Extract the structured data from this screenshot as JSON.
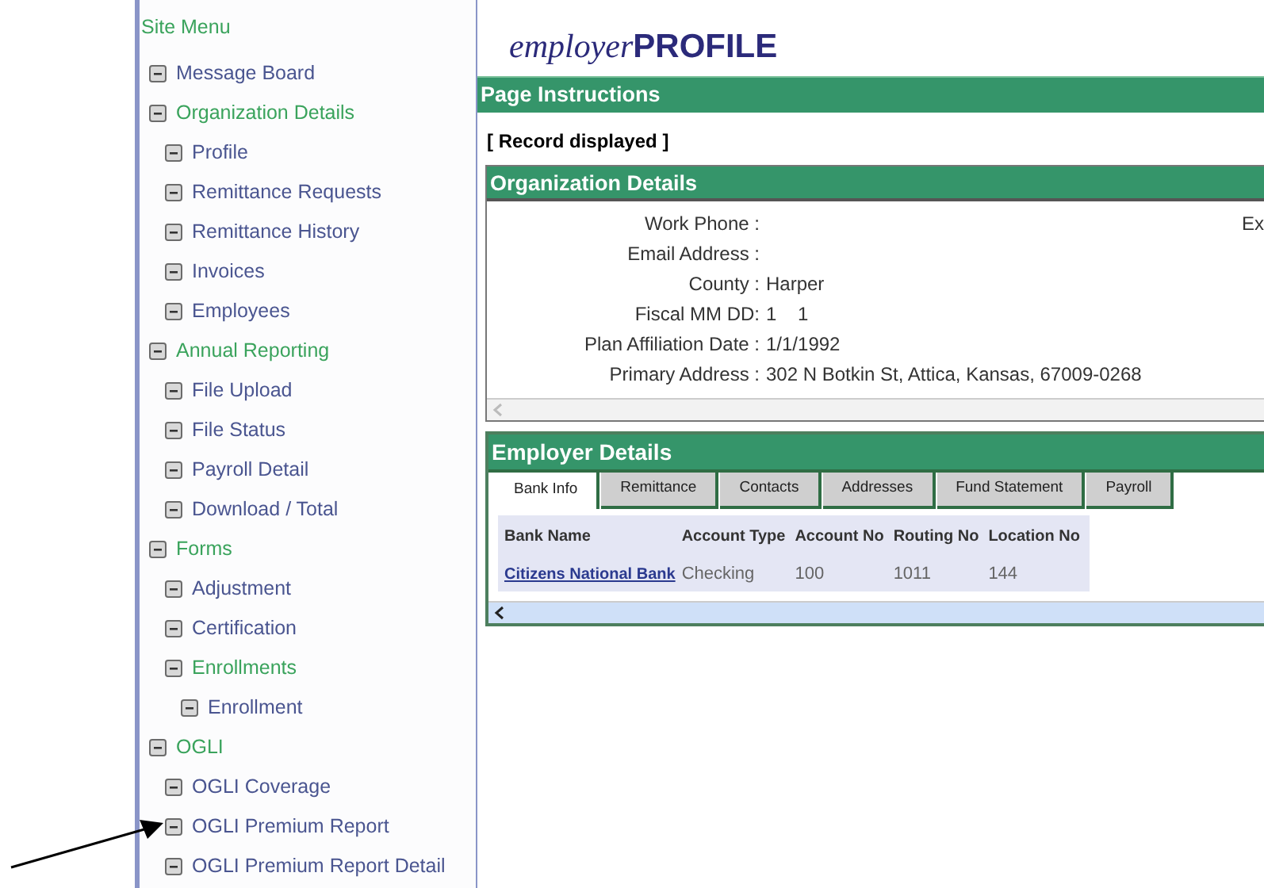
{
  "sidebar": {
    "title": "Site Menu",
    "items": [
      {
        "label": "Message Board",
        "kind": "link"
      },
      {
        "label": "Organization Details",
        "kind": "group",
        "children": [
          {
            "label": "Profile",
            "kind": "link"
          },
          {
            "label": "Remittance Requests",
            "kind": "link"
          },
          {
            "label": "Remittance History",
            "kind": "link"
          },
          {
            "label": "Invoices",
            "kind": "link"
          },
          {
            "label": "Employees",
            "kind": "link"
          }
        ]
      },
      {
        "label": "Annual Reporting",
        "kind": "group",
        "children": [
          {
            "label": "File Upload",
            "kind": "link"
          },
          {
            "label": "File Status",
            "kind": "link"
          },
          {
            "label": "Payroll Detail",
            "kind": "link"
          },
          {
            "label": "Download / Total",
            "kind": "link"
          }
        ]
      },
      {
        "label": "Forms",
        "kind": "group",
        "children": [
          {
            "label": "Adjustment",
            "kind": "link"
          },
          {
            "label": "Certification",
            "kind": "link"
          },
          {
            "label": "Enrollments",
            "kind": "group",
            "children": [
              {
                "label": "Enrollment",
                "kind": "link"
              }
            ]
          }
        ]
      },
      {
        "label": "OGLI",
        "kind": "group",
        "children": [
          {
            "label": "OGLI Coverage",
            "kind": "link"
          },
          {
            "label": "OGLI Premium Report",
            "kind": "link"
          },
          {
            "label": "OGLI Premium Report Detail",
            "kind": "link"
          }
        ]
      }
    ]
  },
  "logo": {
    "prefix": "employer",
    "name": "PROFILE"
  },
  "page_instructions": {
    "title": "Page Instructions",
    "message": "[ Record displayed ]"
  },
  "organization_details": {
    "title": "Organization Details",
    "extension_label": "Ex",
    "fields": [
      {
        "label": "Work Phone :"
      },
      {
        "label": "Email Address :"
      },
      {
        "label": "County :",
        "value": "Harper"
      },
      {
        "label": "Fiscal MM DD:",
        "value": "1    1"
      },
      {
        "label": "Plan Affiliation Date :",
        "value": "1/1/1992"
      },
      {
        "label": "Primary Address :",
        "value": "302 N Botkin St, Attica, Kansas, 67009-0268"
      }
    ]
  },
  "employer_details": {
    "title": "Employer Details",
    "tabs": [
      {
        "label": "Bank Info",
        "selected": true
      },
      {
        "label": "Remittance",
        "selected": false
      },
      {
        "label": "Contacts",
        "selected": false
      },
      {
        "label": "Addresses",
        "selected": false
      },
      {
        "label": "Fund Statement",
        "selected": false
      },
      {
        "label": "Payroll",
        "selected": false
      }
    ],
    "table": {
      "columns": [
        "Bank Name",
        "Account Type",
        "Account No",
        "Routing No",
        "Location No"
      ],
      "rows": [
        [
          "Citizens National Bank",
          "Checking",
          "100",
          "1011",
          "144"
        ]
      ]
    }
  }
}
